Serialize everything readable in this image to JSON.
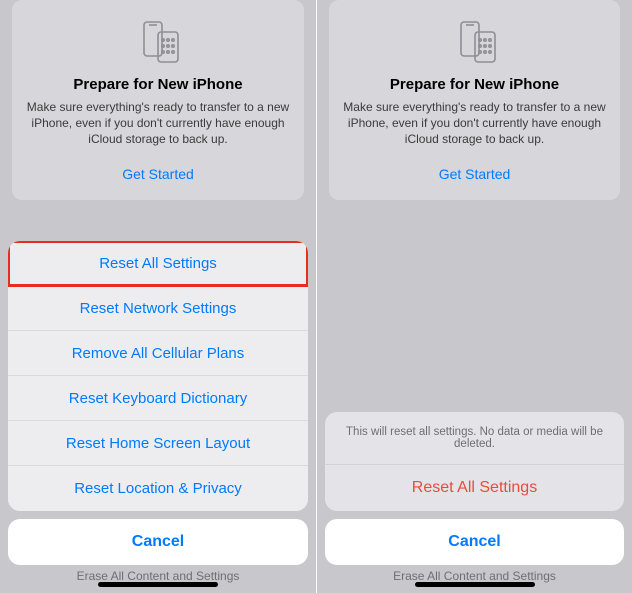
{
  "card": {
    "title": "Prepare for New iPhone",
    "body": "Make sure everything's ready to transfer to a new iPhone, even if you don't currently have enough iCloud storage to back up.",
    "link": "Get Started"
  },
  "left": {
    "options": {
      "reset_all": "Reset All Settings",
      "reset_network": "Reset Network Settings",
      "remove_cellular": "Remove All Cellular Plans",
      "reset_keyboard": "Reset Keyboard Dictionary",
      "reset_home": "Reset Home Screen Layout",
      "reset_location": "Reset Location & Privacy"
    },
    "cancel": "Cancel",
    "peek": "Erase All Content and Settings"
  },
  "right": {
    "confirm_message": "This will reset all settings. No data or media will be deleted.",
    "confirm_action": "Reset All Settings",
    "cancel": "Cancel",
    "peek": "Erase All Content and Settings"
  }
}
